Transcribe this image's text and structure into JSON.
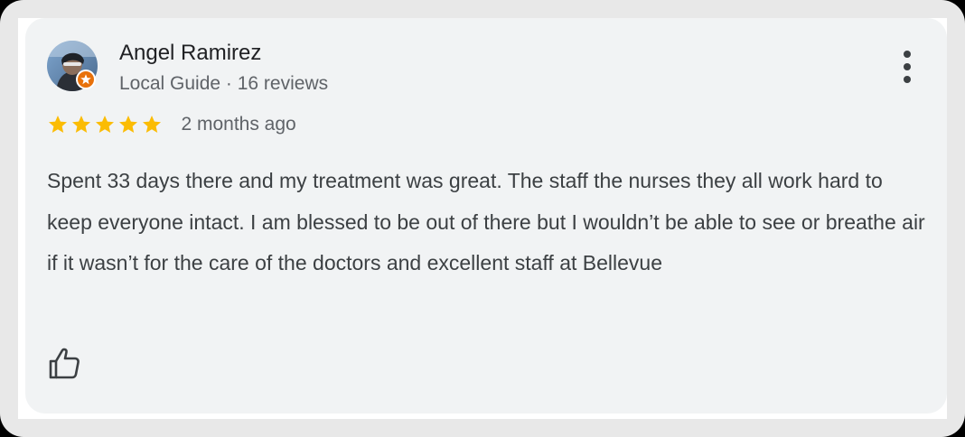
{
  "review": {
    "author_name": "Angel Ramirez",
    "author_meta": "Local Guide · 16 reviews",
    "rating": 5,
    "rating_max": 5,
    "date": "2 months ago",
    "text": "Spent 33 days there and my treatment was great. The staff the nurses they all work hard to keep everyone intact. I am blessed to be out of there but I wouldn’t be able to see or breathe air if it wasn’t for the care of the doctors and excellent staff at Bellevue"
  },
  "icons": {
    "avatar": "user-photo",
    "badge": "local-guide-star-badge",
    "more": "more-vert-icon",
    "star": "star-icon",
    "like": "thumbs-up-icon"
  },
  "colors": {
    "card_background": "#f1f3f4",
    "star": "#fbbc04",
    "badge": "#e8710a",
    "text_primary": "#202124",
    "text_secondary": "#5f6368"
  }
}
